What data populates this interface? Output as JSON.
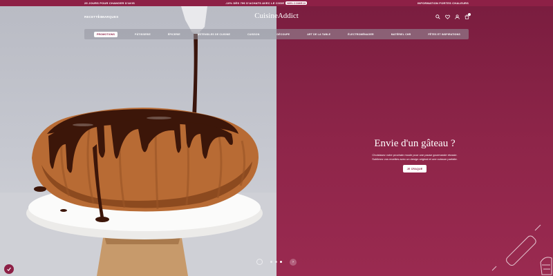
{
  "topbar": {
    "left": "25 JOURS POUR CHANGER D'AVIS",
    "center": "-10% DÈS 79€ D'ACHATS AVEC LE CODE",
    "code": "WELCOME10",
    "right": "INFORMATION FORTES CHALEURS"
  },
  "header": {
    "links": [
      "RECETTES",
      "MARQUES"
    ],
    "separator": "|",
    "logo": "CuisineAddict"
  },
  "nav": {
    "items": [
      "PROMOTIONS",
      "PÂTISSERIE",
      "ÉPICERIE",
      "USTENSILES DE CUISINE",
      "CUISSON",
      "DÉCOUPE",
      "ART DE LA TABLE",
      "ÉLECTROMÉNAGER",
      "MATÉRIEL CHR",
      "FÊTES ET INSPIRATIONS"
    ],
    "active_index": 0
  },
  "hero": {
    "title": "Envie d'un gâteau ?",
    "description": "Choisissez votre prochain moule pour une pause gourmande réussie. Sublimez vos recettes avec un design original et une cuisson parfaite.",
    "button": "JE CRAQUE"
  },
  "slider": {
    "slide_count": 3,
    "active_slide": 2,
    "next_arrow": "›"
  },
  "colors": {
    "brand": "#8d2046",
    "hero_right": "#8e2549"
  }
}
